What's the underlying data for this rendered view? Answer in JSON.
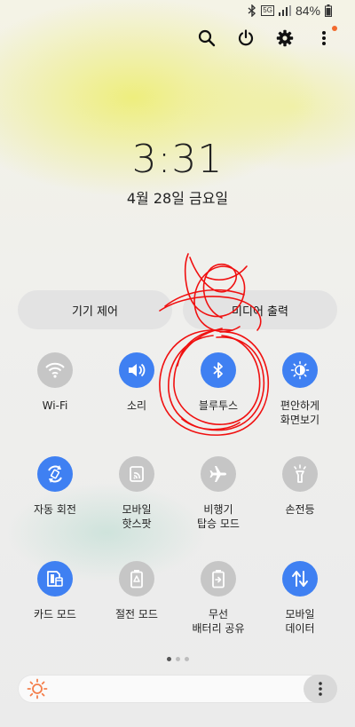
{
  "status_bar": {
    "network_badge": "5G",
    "battery_percent": "84%",
    "icons": [
      "bluetooth-icon",
      "5g-icon",
      "signal-icon",
      "battery-icon"
    ]
  },
  "top_actions": [
    "search-icon",
    "power-icon",
    "gear-icon",
    "more-vertical-icon"
  ],
  "clock": {
    "time": "3:31",
    "date": "4월 28일 금요일"
  },
  "pills": {
    "device_control": "기기 제어",
    "media_output": "미디어 출력"
  },
  "tiles": [
    {
      "label": "Wi-Fi",
      "icon": "wifi-icon",
      "on": false
    },
    {
      "label": "소리",
      "icon": "sound-icon",
      "on": true
    },
    {
      "label": "블루투스",
      "icon": "bluetooth-icon",
      "on": true
    },
    {
      "label": "편안하게\n화면보기",
      "icon": "eye-comfort-icon",
      "on": true
    },
    {
      "label": "자동 회전",
      "icon": "auto-rotate-icon",
      "on": true
    },
    {
      "label": "모바일\n핫스팟",
      "icon": "hotspot-icon",
      "on": false
    },
    {
      "label": "비행기\n탑승 모드",
      "icon": "airplane-icon",
      "on": false
    },
    {
      "label": "손전등",
      "icon": "flashlight-icon",
      "on": false
    },
    {
      "label": "카드 모드",
      "icon": "card-mode-icon",
      "on": true
    },
    {
      "label": "절전 모드",
      "icon": "power-saving-icon",
      "on": false
    },
    {
      "label": "무선\n배터리 공유",
      "icon": "wireless-battery-icon",
      "on": false
    },
    {
      "label": "모바일\n데이터",
      "icon": "mobile-data-icon",
      "on": true
    }
  ],
  "colors": {
    "accent": "#3f80f2",
    "off": "#c6c6c6",
    "scribble": "#f01010"
  },
  "page_indicator": {
    "count": 3,
    "active": 1
  }
}
